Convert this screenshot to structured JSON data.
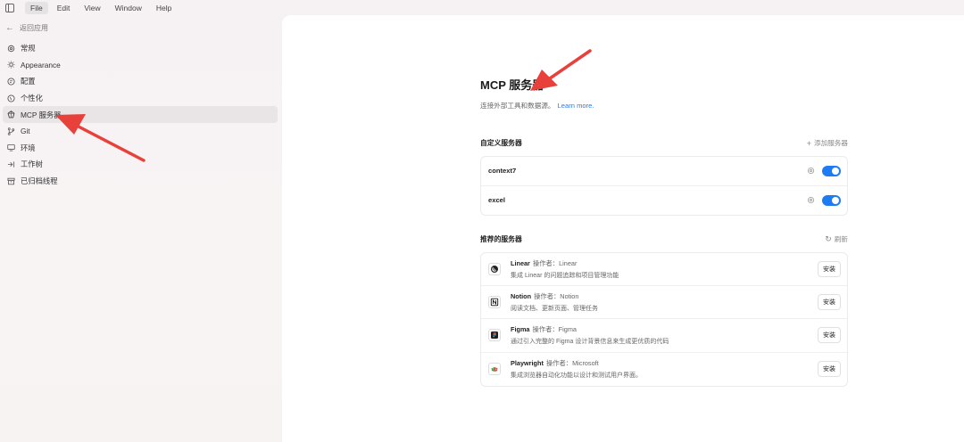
{
  "menubar": {
    "items": [
      "File",
      "Edit",
      "View",
      "Window",
      "Help"
    ]
  },
  "sidebar": {
    "back_label": "返回应用",
    "items": [
      {
        "label": "常规",
        "icon": "gear-icon"
      },
      {
        "label": "Appearance",
        "icon": "sun-icon"
      },
      {
        "label": "配置",
        "icon": "config-icon"
      },
      {
        "label": "个性化",
        "icon": "personalize-icon"
      },
      {
        "label": "MCP 服务器",
        "icon": "mcp-icon",
        "active": true
      },
      {
        "label": "Git",
        "icon": "git-branch-icon"
      },
      {
        "label": "环境",
        "icon": "monitor-icon"
      },
      {
        "label": "工作树",
        "icon": "worktree-icon"
      },
      {
        "label": "已归档线程",
        "icon": "archive-icon"
      }
    ]
  },
  "main": {
    "title": "MCP 服务器",
    "subtitle": "连接外部工具和数据源。",
    "learn_more": "Learn more.",
    "custom": {
      "heading": "自定义服务器",
      "add_label": "添加服务器",
      "servers": [
        {
          "name": "context7",
          "enabled": true
        },
        {
          "name": "excel",
          "enabled": true
        }
      ]
    },
    "recommended": {
      "heading": "推荐的服务器",
      "refresh_label": "刷新",
      "items": [
        {
          "name": "Linear",
          "operator": "操作者：Linear",
          "desc": "集成 Linear 的问题追踪和项目管理功能",
          "button": "安装",
          "icon": "linear-logo-icon"
        },
        {
          "name": "Notion",
          "operator": "操作者：Notion",
          "desc": "阅读文档、更新页面、管理任务",
          "button": "安装",
          "icon": "notion-logo-icon"
        },
        {
          "name": "Figma",
          "operator": "操作者：Figma",
          "desc": "通过引入完整的 Figma 设计背景信息来生成更优质的代码",
          "button": "安装",
          "icon": "figma-logo-icon"
        },
        {
          "name": "Playwright",
          "operator": "操作者：Microsoft",
          "desc": "集成浏览器自动化功能以设计和测试用户界面。",
          "button": "安装",
          "icon": "playwright-logo-icon"
        }
      ]
    }
  },
  "colors": {
    "accent": "#1e7cf2",
    "link": "#2f7ae5",
    "annotation_arrow": "#e8413c"
  }
}
